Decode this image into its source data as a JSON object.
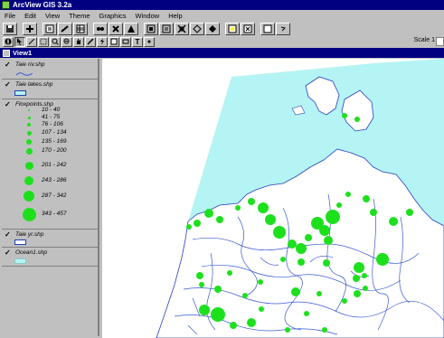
{
  "window": {
    "title": "ArcView GIS 3.2a"
  },
  "menu": [
    "File",
    "Edit",
    "View",
    "Theme",
    "Graphics",
    "Window",
    "Help"
  ],
  "toolbar2_text_tool": "T",
  "scale": {
    "label": "Scale 1"
  },
  "view": {
    "title": "View1"
  },
  "toc": {
    "themes": [
      {
        "name": "Taie riv.shp",
        "checked": true
      },
      {
        "name": "Taie lakes.shp",
        "checked": true
      },
      {
        "name": "Floxpoints.shp",
        "checked": true
      },
      {
        "name": "Taie yr.shp",
        "checked": true
      },
      {
        "name": "Ocean1.shp",
        "checked": true
      }
    ],
    "point_classes": [
      "10 - 40",
      "41 - 75",
      "76 - 106",
      "107 - 134",
      "135 - 169",
      "170 - 200",
      "201 - 242",
      "243 - 286",
      "287 - 342",
      "343 - 457"
    ]
  },
  "colors": {
    "ocean": "#b4f4f4",
    "points": "#1de01d",
    "rivers": "#3a5ad0",
    "titlebar": "#000080"
  },
  "icons": [
    "save-icon",
    "add-theme-icon",
    "properties-icon",
    "table-icon",
    "find-icon",
    "query-icon",
    "zoom-full-icon",
    "zoom-active-icon",
    "zoom-selected-icon",
    "zoom-in-icon",
    "zoom-out-icon",
    "select-feature-icon",
    "clear-selection-icon",
    "layout-icon",
    "help-icon"
  ]
}
